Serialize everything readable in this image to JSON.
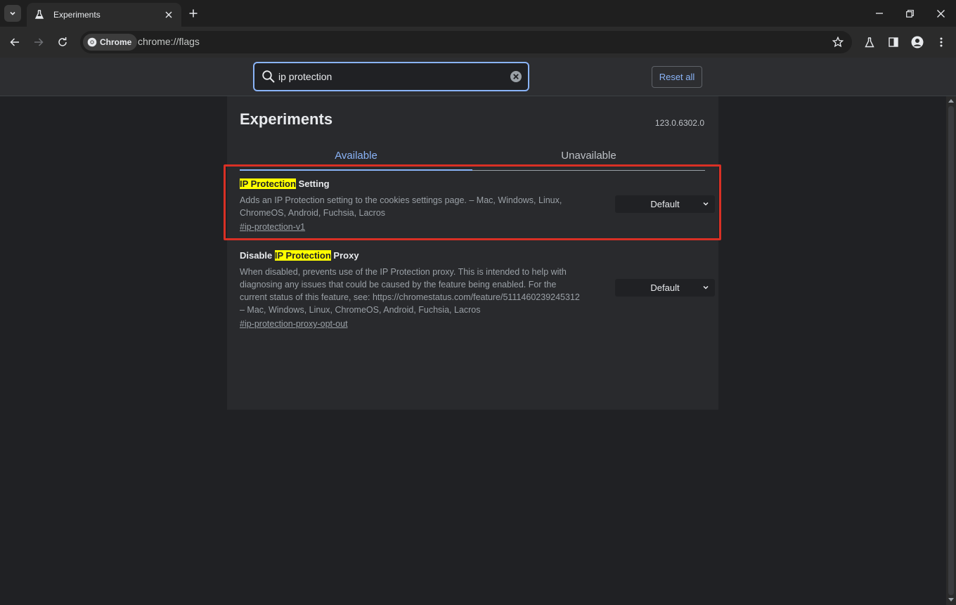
{
  "browser": {
    "tab": {
      "title": "Experiments",
      "icon": "flask-icon"
    },
    "chip_label": "Chrome",
    "url": "chrome://flags",
    "accent": "#8ab4f8"
  },
  "flags_header": {
    "search_value": "ip protection",
    "reset_label": "Reset all"
  },
  "page": {
    "title": "Experiments",
    "version": "123.0.6302.0",
    "tabs": {
      "available": "Available",
      "unavailable": "Unavailable"
    }
  },
  "flags": [
    {
      "title_highlight": "IP Protection",
      "title_after": " Setting",
      "description": "Adds an IP Protection setting to the cookies settings page. – Mac, Windows, Linux, ChromeOS, Android, Fuchsia, Lacros",
      "link": "#ip-protection-v1",
      "select_value": "Default"
    },
    {
      "title_before": "Disable ",
      "title_highlight": "IP Protection",
      "title_after": " Proxy",
      "description": "When disabled, prevents use of the IP Protection proxy. This is intended to help with diagnosing any issues that could be caused by the feature being enabled. For the current status of this feature, see: https://chromestatus.com/feature/5111460239245312 – Mac, Windows, Linux, ChromeOS, Android, Fuchsia, Lacros",
      "link": "#ip-protection-proxy-opt-out",
      "select_value": "Default"
    }
  ],
  "annotation_color": "#d93025"
}
